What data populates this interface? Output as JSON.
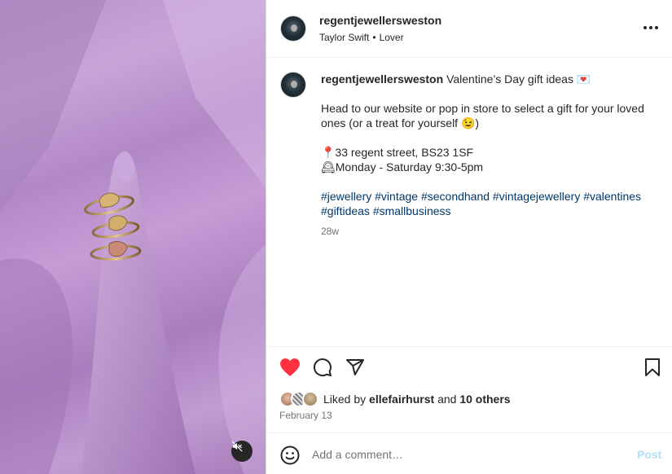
{
  "post": {
    "username": "regentjewellersweston",
    "audio_artist": "Taylor Swift",
    "audio_separator": "•",
    "audio_title": "Lover",
    "more_icon": "more-horizontal-icon"
  },
  "caption": {
    "username": "regentjewellersweston",
    "headline": "Valentine’s Day gift ideas 💌",
    "body": "Head to our website or pop in store to select a gift for your loved ones (or a treat for yourself 😉)",
    "address": "📍33 regent street, BS23 1SF",
    "hours": "🕰Monday - Saturday 9:30-5pm",
    "hashtags": "#jewellery #vintage #secondhand #vintagejewellery #valentines #giftideas #smallbusiness",
    "time_ago": "28w"
  },
  "actions": {
    "like_icon": "heart-filled-icon",
    "comment_icon": "comment-icon",
    "share_icon": "share-icon",
    "save_icon": "bookmark-icon",
    "like_color": "#ff3040"
  },
  "likes": {
    "prefix": "Liked by",
    "user": "ellefairhurst",
    "conjunction": "and",
    "others": "10 others",
    "date": "February 13"
  },
  "comment_box": {
    "placeholder": "Add a comment…",
    "post_label": "Post"
  },
  "media": {
    "mute_icon": "speaker-muted-icon"
  }
}
